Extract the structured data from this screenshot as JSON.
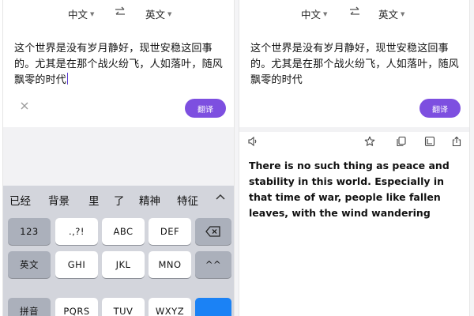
{
  "left": {
    "source_lang": "中文",
    "target_lang": "英文",
    "source_text": "这个世界是没有岁月静好，现世安稳这回事的。尤其是在那个战火纷飞，人如落叶，随风飘零的时代",
    "translate_label": "翻译",
    "candidates": [
      "已经",
      "背景",
      "里",
      "了",
      "精神",
      "特征"
    ],
    "keys": {
      "row1": [
        "123",
        ".,?!",
        "ABC",
        "DEF"
      ],
      "row2": [
        "英文",
        "GHI",
        "JKL",
        "MNO",
        "^^"
      ],
      "row3": [
        "拼音",
        "PQRS",
        "TUV",
        "WXYZ"
      ]
    }
  },
  "right": {
    "source_lang": "中文",
    "target_lang": "英文",
    "source_text": "这个世界是没有岁月静好，现世安稳这回事的。尤其是在那个战火纷飞，人如落叶，随风飘零的时代",
    "translate_label": "翻译",
    "result_text": "There is no such thing as peace and stability in this world. Especially in that time of war, people like fallen leaves, with the wind wandering"
  },
  "icons": {
    "swap": "swap-arrows-icon",
    "clear": "close-icon",
    "speaker": "speaker-icon",
    "favorite": "star-icon",
    "copy": "copy-icon",
    "fullscreen": "fullscreen-icon",
    "share": "share-icon",
    "backspace": "backspace-icon",
    "collapse": "chevron-up-icon"
  },
  "colors": {
    "accent": "#7d4fe0",
    "keyboard_bg": "#d3d5dc",
    "function_key": "#abb0bb",
    "key_blue": "#1b82f5"
  }
}
